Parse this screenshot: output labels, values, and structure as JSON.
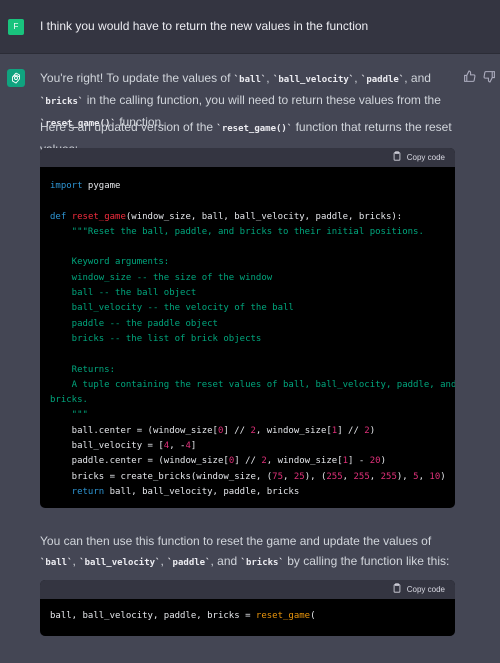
{
  "user": {
    "avatar_letter": "F",
    "message": "I think you would have to return the new values in the function"
  },
  "assistant": {
    "intro": {
      "t1": "You're right! To update the values of ",
      "c1": "`ball`",
      "t2": ", ",
      "c2": "`ball_velocity`",
      "t3": ", ",
      "c3": "`paddle`",
      "t4": ", and ",
      "c4": "`bricks`",
      "t5": " in the calling function, you will need to return these values from the ",
      "c5": "`reset_game()`",
      "t6": " function."
    },
    "p2": {
      "t1": "Here's an updated version of the ",
      "c1": "`reset_game()`",
      "t2": " function that returns the reset values:"
    },
    "p3": {
      "t1": "You can then use this function to reset the game and update the values of ",
      "c1": "`ball`",
      "t2": ", ",
      "c2": "`ball_velocity`",
      "t3": ", ",
      "c3": "`paddle`",
      "t4": ", and ",
      "c4": "`bricks`",
      "t5": " by calling the function like this:"
    },
    "code1": {
      "copy_label": "Copy code",
      "l1_kw": "import",
      "l1_rest": " pygame",
      "l3_kw": "def",
      "l3_fn": "reset_game",
      "l3_rest": "(window_size, ball, ball_velocity, paddle, bricks):",
      "doc": [
        "    \"\"\"Reset the ball, paddle, and bricks to their initial positions.",
        "",
        "    Keyword arguments:",
        "    window_size -- the size of the window",
        "    ball -- the ball object",
        "    ball_velocity -- the velocity of the ball",
        "    paddle -- the paddle object",
        "    bricks -- the list of brick objects",
        "",
        "    Returns:",
        "    A tuple containing the reset values of ball, ball_velocity, paddle, and",
        "bricks.",
        "    \"\"\""
      ],
      "a1": "    ball.center = (window_size[",
      "n0a": "0",
      "a2": "] // ",
      "n2a": "2",
      "a3": ", window_size[",
      "n1a": "1",
      "a4": "] // ",
      "n2b": "2",
      "a5": ")",
      "b1": "    ball_velocity = [",
      "n4": "4",
      "b2": ", -",
      "n4b": "4",
      "b3": "]",
      "c1": "    paddle.center = (window_size[",
      "n0c": "0",
      "c2": "] // ",
      "n2c": "2",
      "c3": ", window_size[",
      "n1c": "1",
      "c4": "] - ",
      "n20": "20",
      "c5": ")",
      "d1": "    bricks = create_bricks(window_size, (",
      "n75": "75",
      "d2": ", ",
      "n25": "25",
      "d3": "), (",
      "n255a": "255",
      "d4": ", ",
      "n255b": "255",
      "d5": ", ",
      "n255c": "255",
      "d6": "), ",
      "n5": "5",
      "d7": ", ",
      "n10": "10",
      "d8": ")",
      "e_kw": "    return",
      "e_rest": " ball, ball_velocity, paddle, bricks"
    },
    "code2": {
      "copy_label": "Copy code",
      "l1_plain": "ball, ball_velocity, paddle, bricks = ",
      "l1_fn": "reset_game",
      "l1_tail": "("
    }
  },
  "colors": {
    "background": "#444654",
    "user_row": "#343541",
    "accent_green": "#10a37f",
    "code_bg": "#000000",
    "keyword": "#2e95d3",
    "function": "#f22c3d",
    "docstring": "#00a67d",
    "number": "#df3079"
  },
  "icons": [
    "user-avatar",
    "chatgpt-logo-icon",
    "thumbs-up-icon",
    "thumbs-down-icon",
    "clipboard-icon"
  ]
}
